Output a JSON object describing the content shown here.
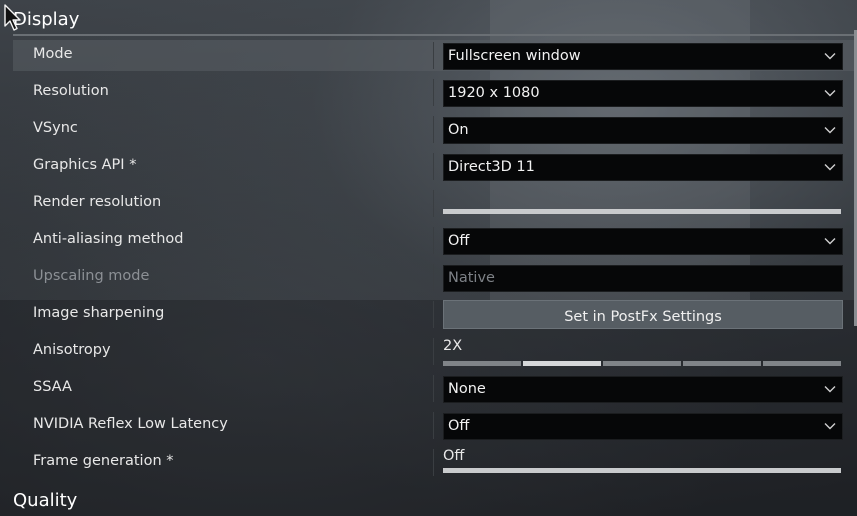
{
  "sections": {
    "display": "Display",
    "quality": "Quality"
  },
  "settings": {
    "mode": {
      "label": "Mode",
      "value": "Fullscreen window"
    },
    "resolution": {
      "label": "Resolution",
      "value": "1920 x 1080"
    },
    "vsync": {
      "label": "VSync",
      "value": "On"
    },
    "graphics_api": {
      "label": "Graphics API *",
      "value": "Direct3D 11"
    },
    "render_resolution": {
      "label": "Render resolution",
      "fill_fraction": 1.0
    },
    "anti_aliasing": {
      "label": "Anti-aliasing method",
      "value": "Off"
    },
    "upscaling_mode": {
      "label": "Upscaling mode",
      "value": "Native"
    },
    "image_sharpening": {
      "label": "Image sharpening",
      "button": "Set in PostFx Settings"
    },
    "anisotropy": {
      "label": "Anisotropy",
      "value": "2X",
      "steps": 5,
      "selected_step": 2
    },
    "ssaa": {
      "label": "SSAA",
      "value": "None"
    },
    "nvidia_reflex": {
      "label": "NVIDIA Reflex Low Latency",
      "value": "Off"
    },
    "frame_generation": {
      "label": "Frame generation *",
      "value": "Off"
    }
  },
  "icons": {
    "dropdown": "chevron-down-icon",
    "cursor": "mouse-pointer-icon"
  },
  "colors": {
    "dropdown_bg": "#060708",
    "button_bg": "#565d63",
    "highlight_row": "#5a5f64",
    "disabled_text": "#8c9095"
  }
}
